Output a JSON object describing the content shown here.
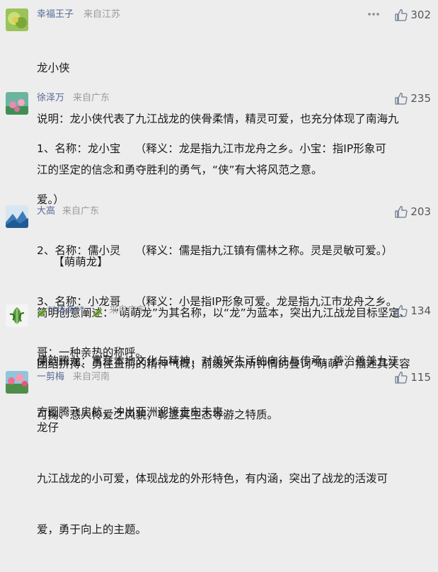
{
  "comments": [
    {
      "username": "幸福王子",
      "location": "来自江苏",
      "likes": "302",
      "has_more": true,
      "lines": [
        "龙小侠",
        "说明：龙小侠代表了九江战龙的侠骨柔情，精灵可爱，也充分体现了南海九",
        "江的坚定的信念和勇夺胜利的勇气，“侠”有大将风范之意。"
      ]
    },
    {
      "username": "徐泽万",
      "location": "来自广东",
      "likes": "235",
      "has_more": false,
      "lines": [
        "1、名称：龙小宝　  （释义：龙是指九江市龙舟之乡。小宝：指IP形象可",
        "爱。）",
        "2、名称：儒小灵　  （释义：儒是指九江镇有儒林之称。灵是灵敏可爱。）",
        "3、名称：小龙哥　  （释义：小是指IP形象可爱。龙是指九江市龙舟之乡。",
        "哥：一种亲热的称呼。"
      ]
    },
    {
      "username": "大高",
      "location": "来自广东",
      "likes": "203",
      "has_more": false,
      "lines": [
        "　　【萌萌龙】",
        "简明创意阐述：“萌萌龙”为其名称，以“龙”为蓝本，突出九江战龙目标坚定、",
        "团结拼搏、勇往直前的精神气概；前缀大众所钟情的叠词“萌萌”，描述其笑容",
        "可掬、惹人怜爱之风貌，彰显其生态导游之特质。"
      ]
    },
    {
      "username": "**传奇**",
      "location": "来自广东",
      "likes": "134",
      "has_more": false,
      "lines": [
        "儒韵腾龙：寓意本地文化与精神，对美好生活的向往与传承，善治善美九江",
        "方圆腾飞启航，冲出亚洲迎接走向未来。"
      ]
    },
    {
      "username": "一剪梅",
      "location": "来自河南",
      "likes": "115",
      "has_more": false,
      "lines": [
        "龙仔",
        "九江战龙的小可爱，体现战龙的外形特色，有内涵，突出了战龙的活泼可",
        "爱，勇于向上的主题。"
      ]
    }
  ],
  "icons": {
    "like": "thumbs-up-icon",
    "more": "more-options-icon",
    "leaf": "leaf-emoji-icon"
  },
  "colors": {
    "username": "#576b95",
    "location": "#9a9a9a",
    "background": "#ededed",
    "text": "#1a1a1a"
  }
}
